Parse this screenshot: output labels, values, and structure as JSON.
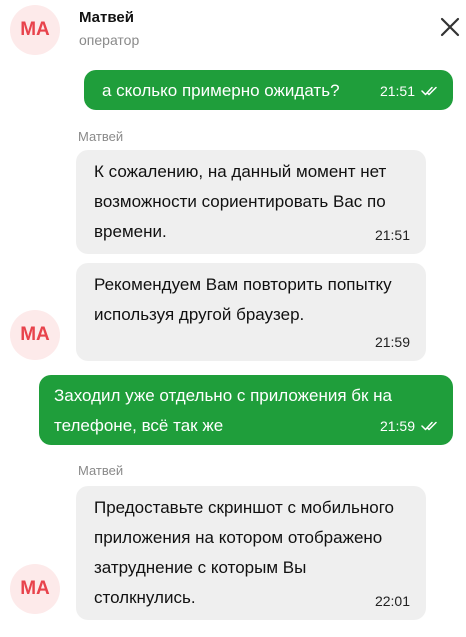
{
  "header": {
    "avatar_initials": "МА",
    "operator_name": "Матвей",
    "operator_role": "оператор"
  },
  "messages": [
    {
      "direction": "out",
      "text": "а сколько примерно ожидать?",
      "time": "21:51",
      "status": "read"
    },
    {
      "direction": "in",
      "sender": "Матвей",
      "text": "К сожалению, на данный момент нет возможности сориентировать Вас по времени.",
      "time": "21:51"
    },
    {
      "direction": "in",
      "text": "Рекомендуем Вам повторить попытку используя другой браузер.",
      "time": "21:59"
    },
    {
      "direction": "out",
      "text": "Заходил уже отдельно с приложения бк на телефоне, всё так же",
      "time": "21:59",
      "status": "read"
    },
    {
      "direction": "in",
      "sender": "Матвей",
      "text": "Предоставьте скриншот с мобильного приложения на котором отображено затруднение с которым Вы столкнулись.",
      "time": "22:01"
    }
  ],
  "colors": {
    "outgoing_bubble": "#1f9e3b",
    "incoming_bubble": "#efefef",
    "avatar_bg": "#fdeaea",
    "avatar_text": "#e8434c"
  },
  "icons": {
    "close": "close-icon",
    "read_receipt": "double-check-icon"
  }
}
